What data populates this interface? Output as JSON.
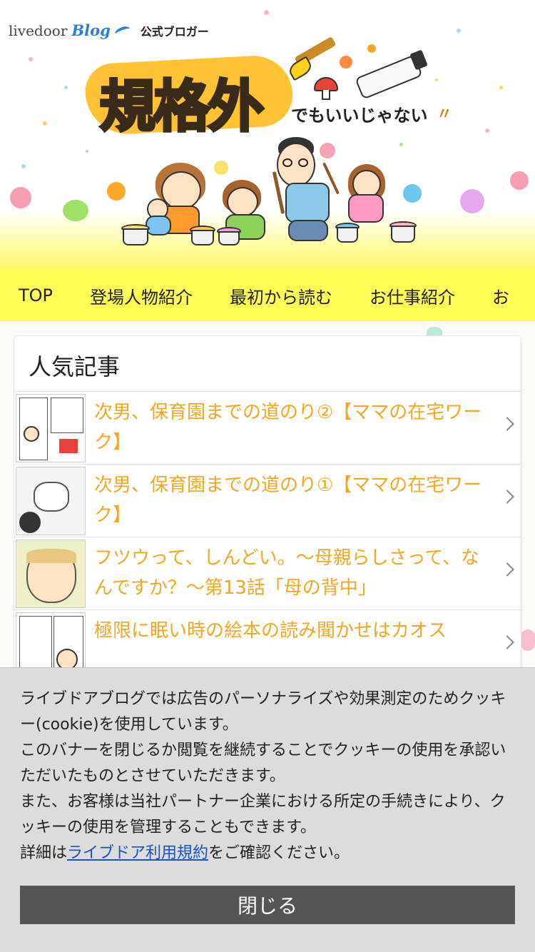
{
  "header": {
    "brand_livedoor": "livedoor",
    "brand_blog": "Blog",
    "brand_official": "公式ブロガー",
    "title_part1": "規格",
    "title_part2": "外",
    "subtitle": "でもいいじゃない",
    "subtitle_marks": "〃"
  },
  "nav": {
    "items": [
      "TOP",
      "登場人物紹介",
      "最初から読む",
      "お仕事紹介",
      "お"
    ]
  },
  "popular": {
    "title": "人気記事",
    "articles": [
      {
        "title": "次男、保育園までの道のり②【ママの在宅ワーク】"
      },
      {
        "title": "次男、保育園までの道のり①【ママの在宅ワーク】"
      },
      {
        "title": "フツウって、しんどい。～母親らしさって、なんですか？～第13話「母の背中」"
      },
      {
        "title": "極限に眠い時の絵本の読み聞かせはカオス"
      }
    ]
  },
  "cookie": {
    "text_1": "ライブドアブログでは広告のパーソナライズや効果測定のためクッキー(cookie)を使用しています。",
    "text_2": "このバナーを閉じるか閲覧を継続することでクッキーの使用を承認いただいたものとさせていただきます。",
    "text_3": "また、お客様は当社パートナー企業における所定の手続きにより、クッキーの使用を管理することもできます。",
    "text_4_prefix": "詳細は",
    "link_label": "ライブドア利用規約",
    "text_4_suffix": "をご確認ください。",
    "close_label": "閉じる"
  },
  "colors": {
    "nav_bg": "#fffd55",
    "article_link": "#f5a623",
    "close_button": "#555555",
    "link": "#1a52c4"
  }
}
